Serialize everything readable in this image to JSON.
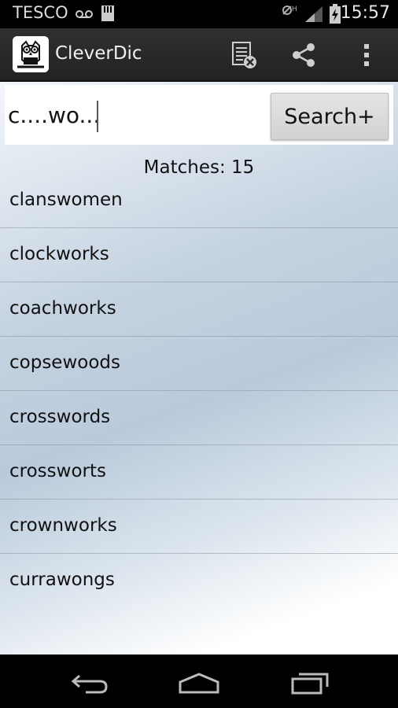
{
  "status_bar": {
    "carrier": "TESCO",
    "time": "15:57",
    "icons": [
      "voicemail-icon",
      "sd-card-icon",
      "no-signal-icon",
      "signal-icon",
      "battery-charging-icon"
    ]
  },
  "action_bar": {
    "title": "CleverDic",
    "icons": [
      "owl-logo-icon",
      "clear-list-icon",
      "share-icon",
      "overflow-menu-icon"
    ]
  },
  "search": {
    "value": "c....wo...",
    "button_label": "Search+"
  },
  "results": {
    "matches_text": "Matches: 15",
    "words": [
      "clanswomen",
      "clockworks",
      "coachworks",
      "copsewoods",
      "crosswords",
      "crossworts",
      "crownworks",
      "currawongs"
    ]
  },
  "nav_bar": {
    "icons": [
      "back-icon",
      "home-icon",
      "recents-icon"
    ]
  },
  "colors": {
    "status_bar_bg": "#000000",
    "action_bar_bg": "#2a2a2a",
    "content_gradient_mid": "#c5d3e1"
  }
}
